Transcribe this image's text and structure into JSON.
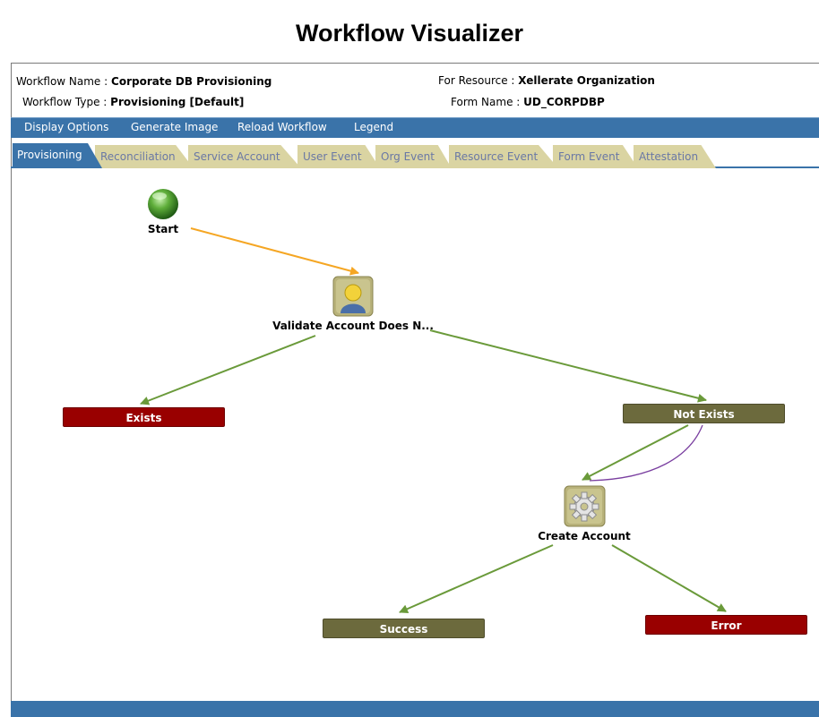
{
  "page_title": "Workflow Visualizer",
  "header": {
    "workflow_name_label": "Workflow Name :",
    "workflow_name_value": "Corporate DB Provisioning",
    "workflow_type_label": "Workflow Type :",
    "workflow_type_value": "Provisioning [Default]",
    "for_resource_label": "For Resource :",
    "for_resource_value": "Xellerate Organization",
    "form_name_label": "Form Name :",
    "form_name_value": "UD_CORPDBP"
  },
  "menu": {
    "items": [
      "Display Options",
      "Generate Image",
      "Reload Workflow",
      "Legend"
    ]
  },
  "tabs": {
    "active": "Provisioning",
    "items": [
      "Provisioning",
      "Reconciliation",
      "Service Account",
      "User Event",
      "Org Event",
      "Resource Event",
      "Form Event",
      "Attestation"
    ]
  },
  "graph": {
    "start_label": "Start",
    "validate_label": "Validate Account Does N...",
    "exists_label": "Exists",
    "not_exists_label": "Not Exists",
    "create_label": "Create Account",
    "success_label": "Success",
    "error_label": "Error"
  },
  "colors": {
    "menu_blue": "#3a73a9",
    "tab_tan": "#dad4a2",
    "error_red": "#990000",
    "olive": "#6c6a3d",
    "edge_green": "#6a9a3a",
    "edge_orange": "#f5a623",
    "edge_purple": "#7a3fa0"
  }
}
